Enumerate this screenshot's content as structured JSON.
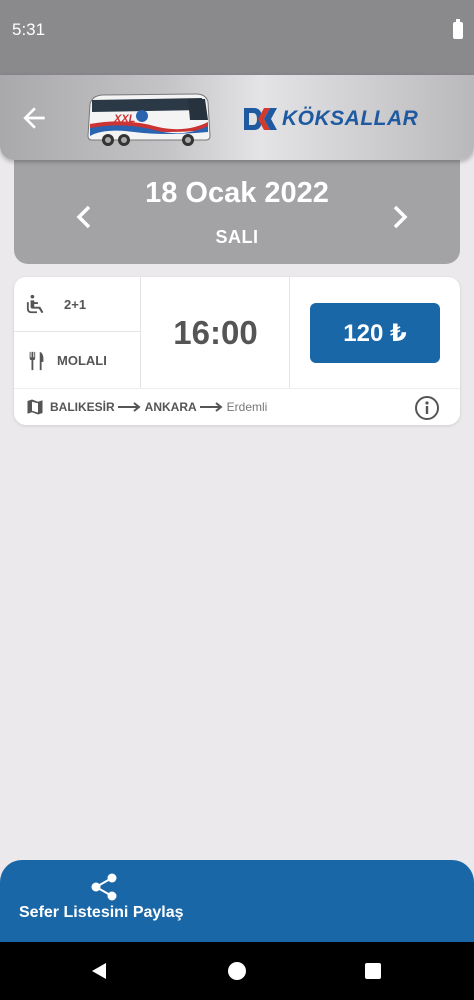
{
  "status_bar": {
    "time": "5:31"
  },
  "header": {
    "brand": "KÖKSALLAR",
    "bus_livery": "XXL"
  },
  "date": {
    "title": "18 Ocak 2022",
    "weekday": "SALI"
  },
  "trip": {
    "seat_layout": "2+1",
    "break_label": "MOLALI",
    "time": "16:00",
    "price": "120 ₺",
    "route_from": "BALIKESİR",
    "route_to": "ANKARA",
    "route_stop": "Erdemli"
  },
  "share": {
    "label": "Sefer Listesini Paylaş"
  },
  "colors": {
    "accent": "#1a67a8",
    "header_bg": "#a3a2a5",
    "background": "#ebe9ec"
  },
  "icons": [
    "arrow-back-icon",
    "chevron-left-icon",
    "chevron-right-icon",
    "seat-icon",
    "utensils-icon",
    "map-icon",
    "info-icon",
    "share-icon"
  ]
}
